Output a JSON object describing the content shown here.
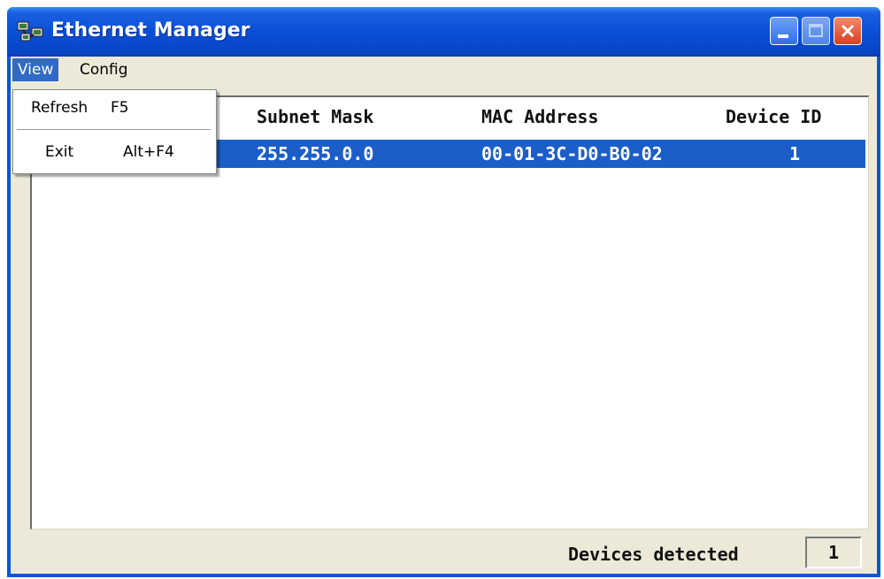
{
  "window": {
    "title": "Ethernet Manager",
    "icon": "network-computers-icon",
    "controls": [
      "minimize-icon",
      "maximize-icon",
      "close-icon"
    ]
  },
  "menubar": {
    "items": [
      {
        "label": "View",
        "active": true
      },
      {
        "label": "Config",
        "active": false
      }
    ]
  },
  "view_menu": {
    "items": [
      {
        "label": "Refresh",
        "shortcut": "F5"
      },
      {
        "label": "Exit",
        "shortcut": "Alt+F4"
      }
    ]
  },
  "table": {
    "columns": [
      "Subnet Mask",
      "MAC Address",
      "Device ID"
    ],
    "rows": [
      {
        "subnet_mask": "255.255.0.0",
        "mac_address": "00-01-3C-D0-B0-02",
        "device_id": "1",
        "selected": true
      }
    ]
  },
  "status": {
    "label": "Devices detected",
    "count": "1"
  },
  "colors": {
    "title_bar": "#0a4fd6",
    "selection": "#1c5ec8",
    "window_face": "#ece9d8",
    "close_button": "#d8411f"
  }
}
